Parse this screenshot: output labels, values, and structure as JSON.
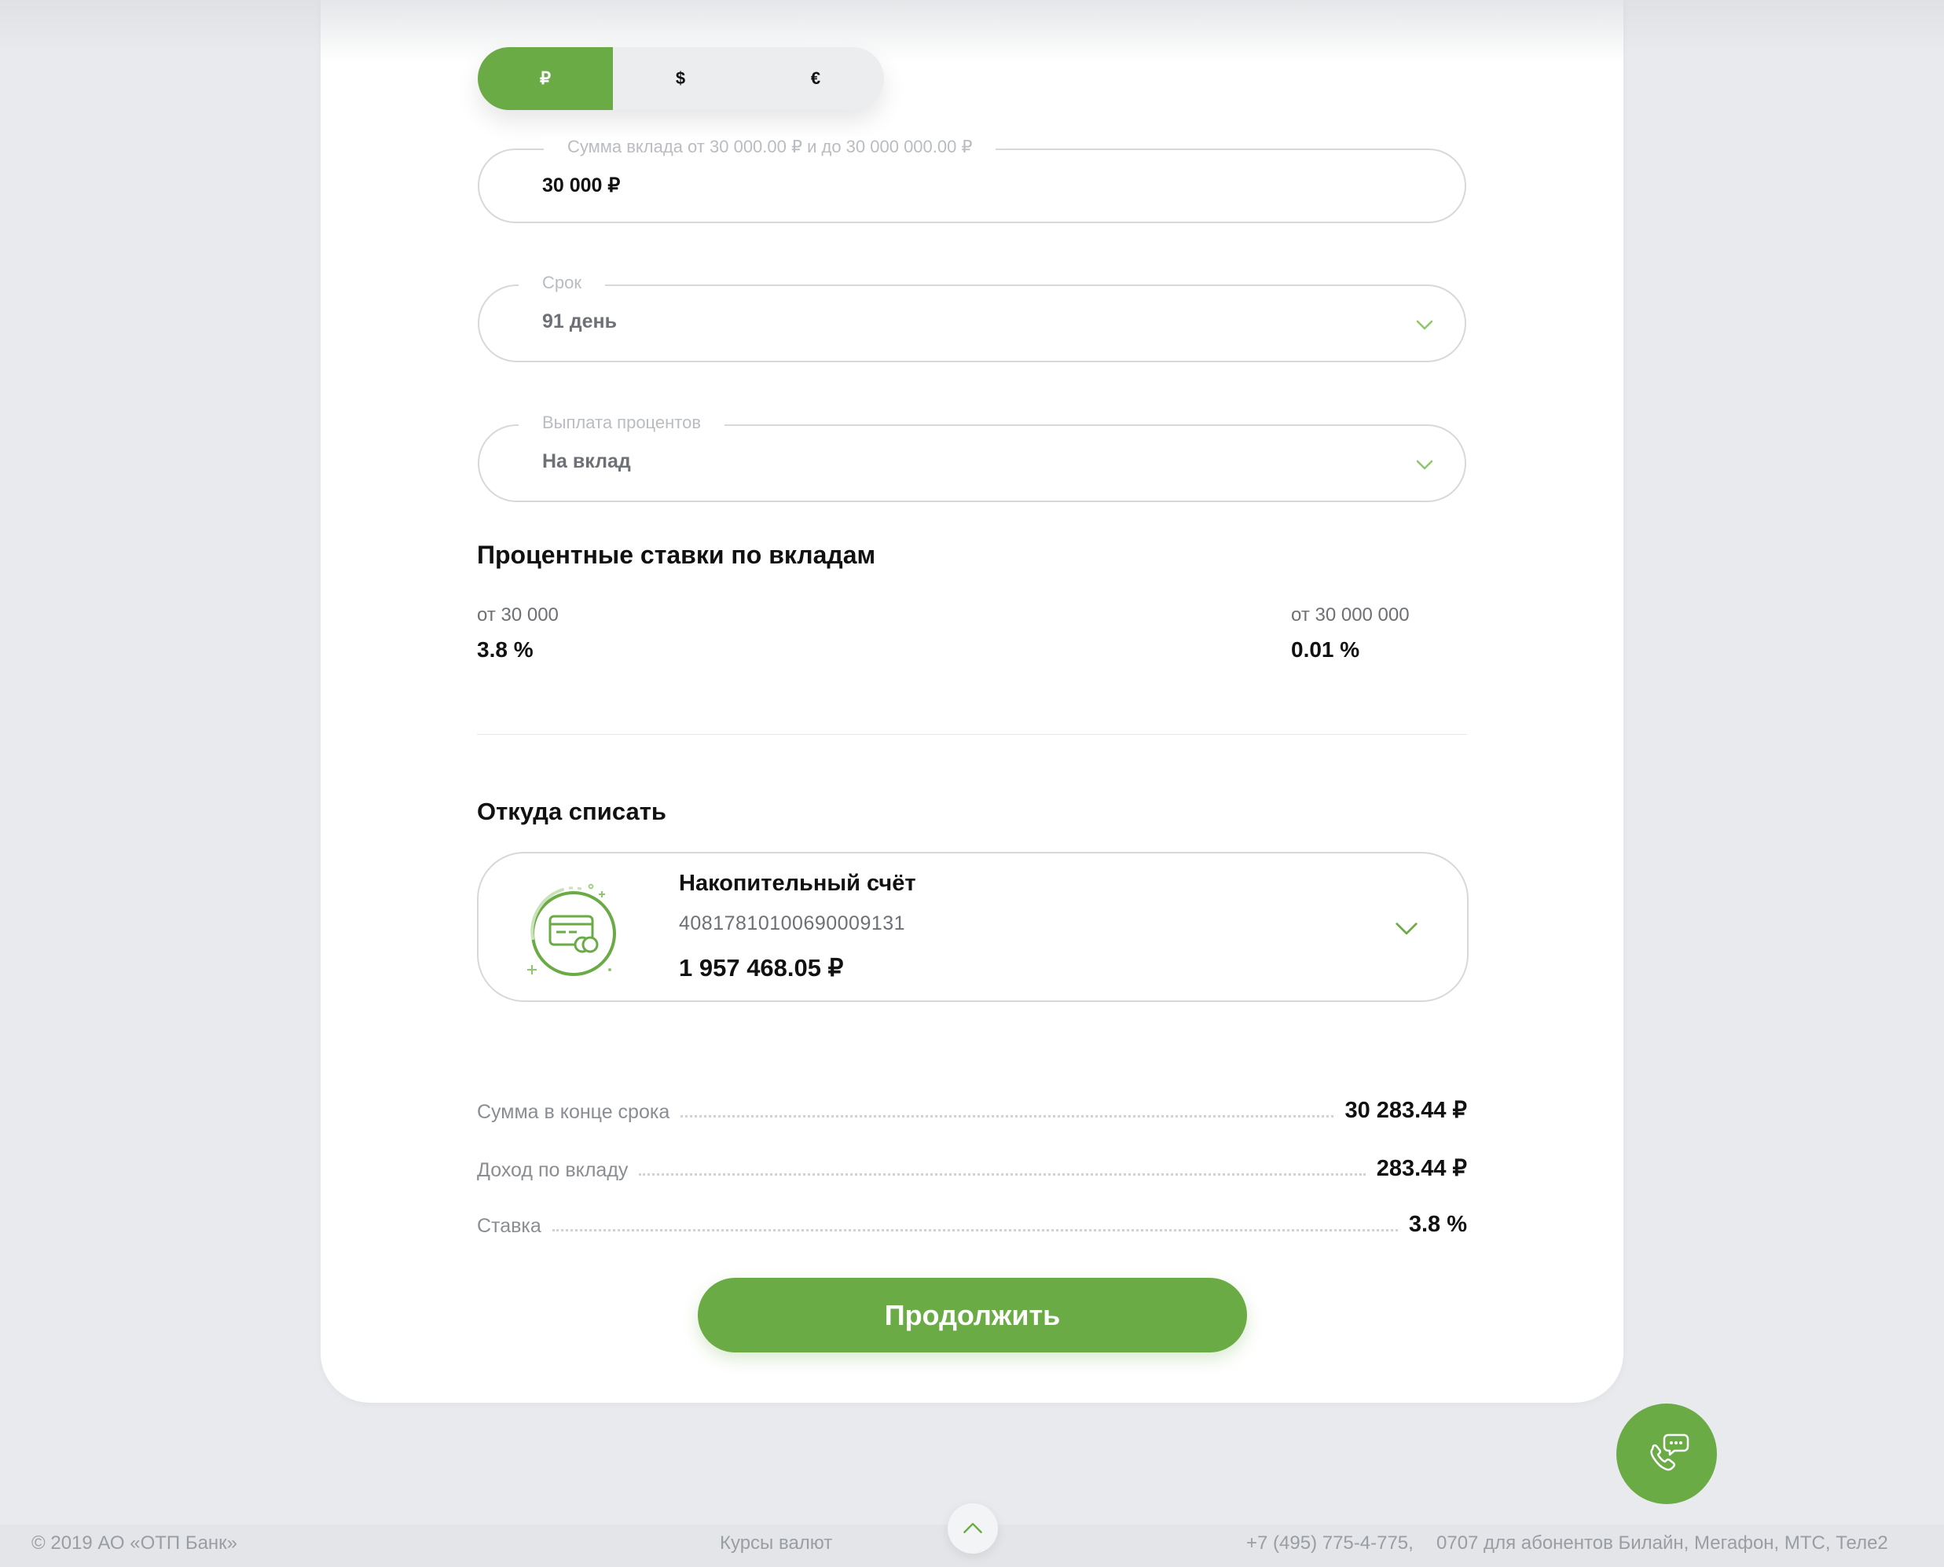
{
  "currency": {
    "options": [
      "₽",
      "$",
      "€"
    ],
    "selected": "₽"
  },
  "amount_field": {
    "label": "Сумма вклада от 30 000.00 ₽ и до 30 000 000.00 ₽",
    "value": "30 000 ₽"
  },
  "term_field": {
    "label": "Срок",
    "value": "91 день"
  },
  "payout_field": {
    "label": "Выплата процентов",
    "value": "На вклад"
  },
  "rates": {
    "title": "Процентные ставки по вкладам",
    "tiers": [
      {
        "label": "от 30 000",
        "rate": "3.8 %"
      },
      {
        "label": "от 30 000 000",
        "rate": "0.01 %"
      }
    ]
  },
  "source": {
    "title": "Откуда списать",
    "account_name": "Накопительный счёт",
    "account_number": "40817810100690009131",
    "balance": "1 957 468.05 ₽"
  },
  "summary": [
    {
      "label": "Сумма в конце срока",
      "value": "30 283.44 ₽"
    },
    {
      "label": "Доход по вкладу",
      "value": "283.44 ₽"
    },
    {
      "label": "Ставка",
      "value": "3.8 %"
    }
  ],
  "continue_label": "Продолжить",
  "footer": {
    "copyright": "© 2019 АО «ОТП Банк»",
    "rates_link": "Курсы валют",
    "phone": "+7 (495) 775-4-775,",
    "short_number": "0707 для абонентов Билайн, Мегафон, МТС, Теле2"
  },
  "colors": {
    "accent": "#6aab45",
    "border": "#d6d8db",
    "background": "#e8eaed"
  },
  "icons": [
    "chevron-down-icon",
    "savings-account-icon",
    "phone-chat-icon",
    "chevron-up-icon"
  ]
}
